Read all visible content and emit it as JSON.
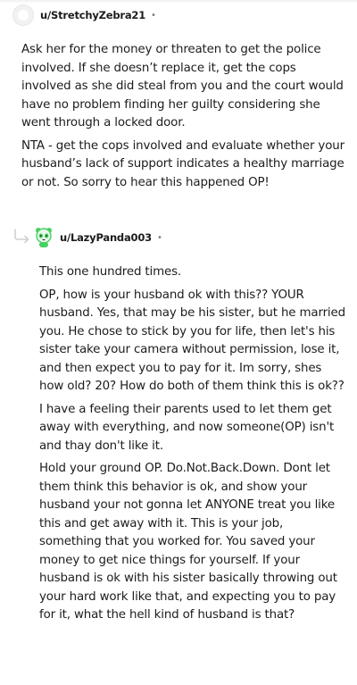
{
  "comments": [
    {
      "username": "u/StretchyZebra21",
      "separator": "•",
      "avatar_icon": "default-avatar-icon",
      "paragraphs": [
        "Ask her for the money or threaten to get the police involved. If she doesn’t replace it, get the cops involved as she did steal from you and the court would have no problem finding her guilty considering she went through a locked door.",
        "NTA - get the cops involved and evaluate whether your husband’s lack of support indicates a healthy marriage or not. So sorry to hear this happened OP!"
      ]
    },
    {
      "username": "u/LazyPanda003",
      "separator": "•",
      "avatar_icon": "green-panda-avatar-icon",
      "reply_icon": "reply-arrow-icon",
      "paragraphs": [
        "This one hundred times.",
        "OP, how is your husband ok with this?? YOUR husband. Yes, that may be his sister, but he married you. He chose to stick by you for life, then let's his sister take your camera without permission, lose it, and then expect you to pay for it. Im sorry, shes how old? 20? How do both of them think this is ok??",
        "I have a feeling their parents used to let them get away with everything, and now someone(OP) isn't and thay don't like it.",
        "Hold your ground OP. Do.Not.Back.Down. Dont let them think this behavior is ok, and show your husband your not gonna let ANYONE treat you like this and get away with it. This is your job, something that you worked for. You saved your money to get nice things for yourself. If your husband is ok with his sister basically throwing out your hard work like that, and expecting you to pay for it, what the hell kind of husband is that?"
      ]
    }
  ],
  "colors": {
    "text": "#1c1c1c",
    "muted": "#7c7c7c",
    "panda_green": "#46d160",
    "reply_line": "#d0d0d0"
  }
}
